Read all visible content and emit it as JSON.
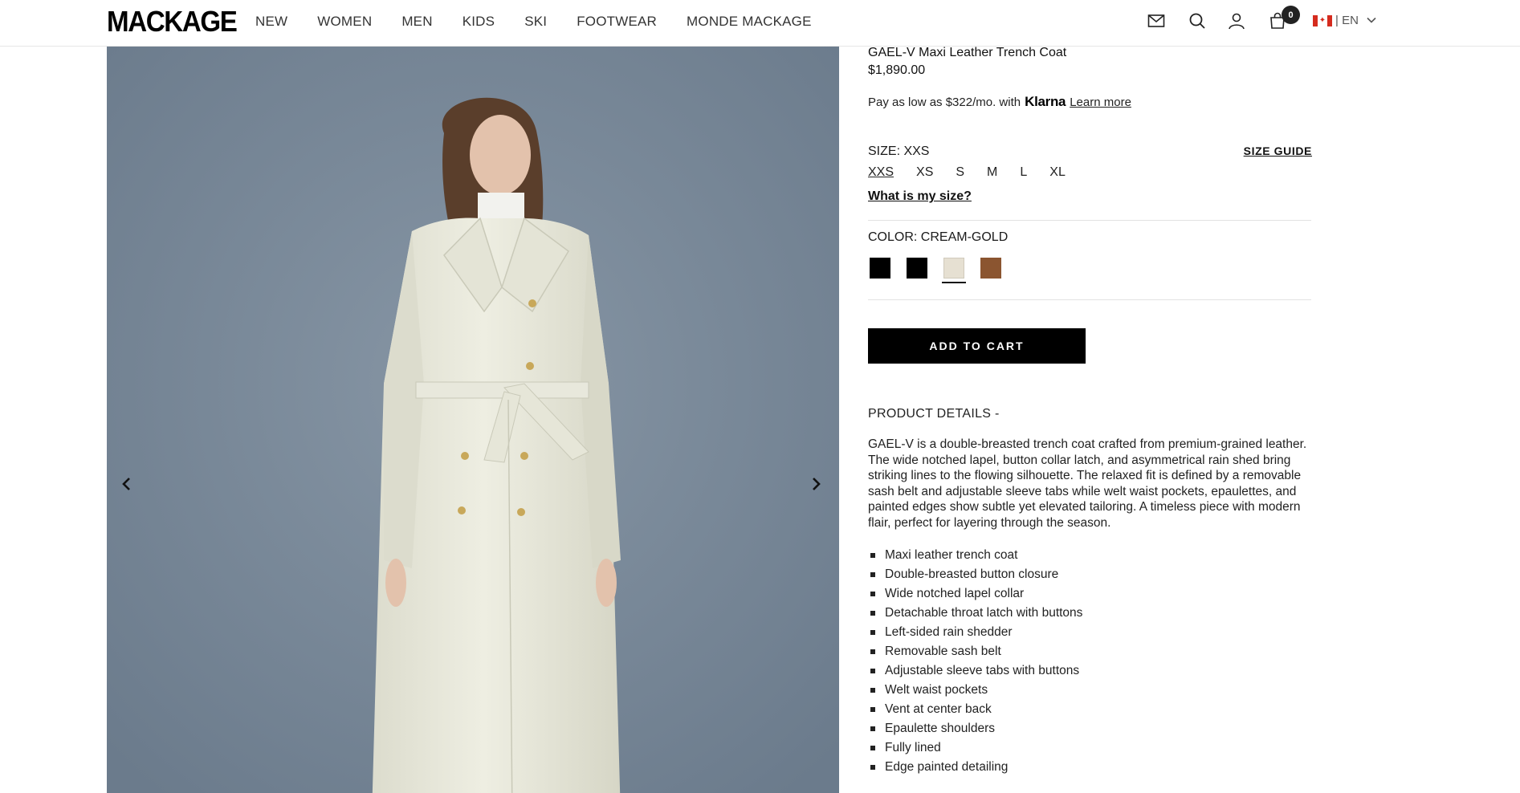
{
  "brand": "MACKAGE",
  "nav": [
    "NEW",
    "WOMEN",
    "MEN",
    "KIDS",
    "SKI",
    "FOOTWEAR",
    "MONDE MACKAGE"
  ],
  "header": {
    "cart_count": "0",
    "locale": "| EN",
    "icons": [
      "mail-icon",
      "search-icon",
      "account-icon",
      "cart-icon",
      "canada-flag-icon",
      "chevron-down-icon"
    ]
  },
  "product": {
    "title": "GAEL-V Maxi Leather Trench Coat",
    "price": "$1,890.00",
    "klarna": {
      "text": "Pay as low as $322/mo. with",
      "brand": "Klarna",
      "learn_more": "Learn more"
    },
    "size": {
      "label": "SIZE: XXS",
      "guide": "SIZE GUIDE",
      "options": [
        "XXS",
        "XS",
        "S",
        "M",
        "L",
        "XL"
      ],
      "selected": "XXS",
      "what_is_my_size": "What is my size?"
    },
    "color": {
      "label": "COLOR: CREAM-GOLD",
      "swatches": [
        "#000000",
        "#000000",
        "#e6e0d2",
        "#8b5530"
      ],
      "selected_index": 2
    },
    "add_to_cart": "ADD TO CART",
    "details": {
      "heading": "PRODUCT DETAILS  -",
      "description": "GAEL-V is a double-breasted trench coat crafted from premium-grained leather. The wide notched lapel, button collar latch, and asymmetrical rain shed bring striking lines to the flowing silhouette. The relaxed fit is defined by a removable sash belt and adjustable sleeve tabs while welt waist pockets, epaulettes, and painted edges show subtle yet elevated tailoring. A timeless piece with modern flair, perfect for layering through the season.",
      "bullets": [
        "Maxi leather trench coat",
        "Double-breasted button closure",
        "Wide notched lapel collar",
        "Detachable throat latch with buttons",
        "Left-sided rain shedder",
        "Removable sash belt",
        "Adjustable sleeve tabs with buttons",
        "Welt waist pockets",
        "Vent at center back",
        "Epaulette shoulders",
        "Fully lined",
        "Edge painted detailing"
      ]
    }
  },
  "gallery": {
    "prev_icon": "chevron-left-icon",
    "next_icon": "chevron-right-icon"
  }
}
